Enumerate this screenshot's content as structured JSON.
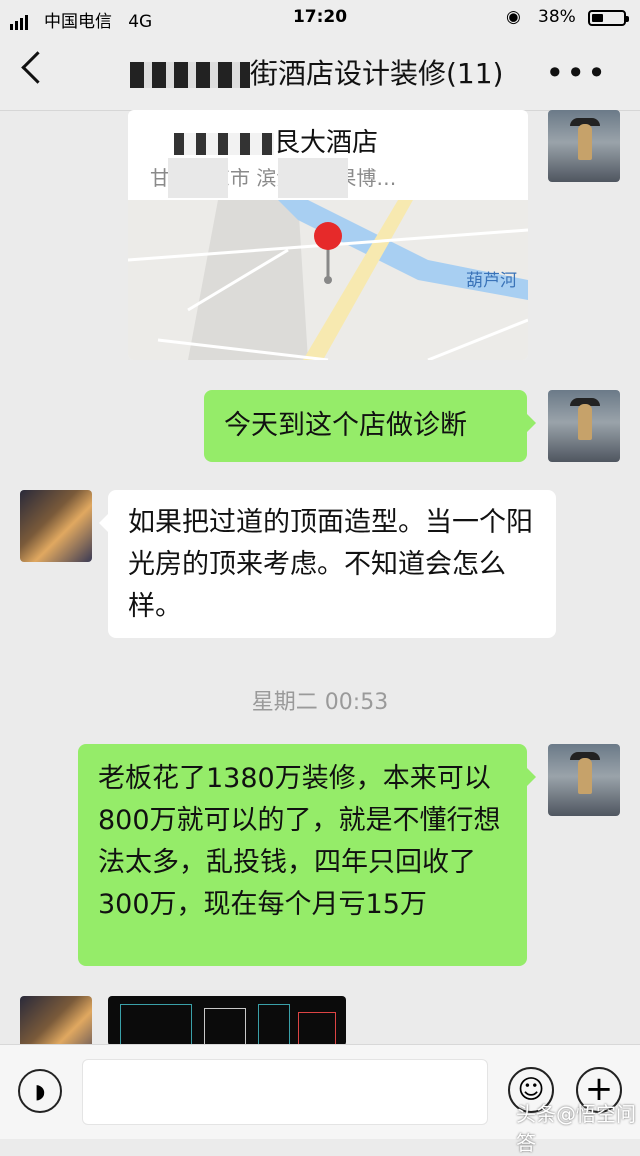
{
  "status_bar": {
    "carrier": "中国电信",
    "network": "4G",
    "time": "17:20",
    "battery_percent": "38%",
    "battery_level": 0.38
  },
  "header": {
    "title": "街酒店设计装修(11)",
    "back_icon": "chevron-left-icon",
    "more_icon": "more-dots-icon"
  },
  "messages": {
    "location": {
      "name": "艮大酒店",
      "address": "甘肃平凉市  滨河路金果博…",
      "map_label": "葫芦河"
    },
    "msg_diagnosis": "今天到这个店做诊断",
    "msg_ceiling": "如果把过道的顶面造型。当一个阳光房的顶来考虑。不知道会怎么样。",
    "timestamp": "星期二 00:53",
    "msg_boss": "老板花了1380万装修，本来可以800万就可以的了，就是不懂行想法太多，乱投钱，四年只回收了300万，现在每个月亏15万"
  },
  "input_bar": {
    "voice_icon": "voice-icon",
    "emoji_icon": "emoji-icon",
    "plus_icon": "plus-icon"
  },
  "watermark": "头条@悟空问答",
  "colors": {
    "green_bubble": "#95ec69",
    "background": "#ebebeb"
  }
}
